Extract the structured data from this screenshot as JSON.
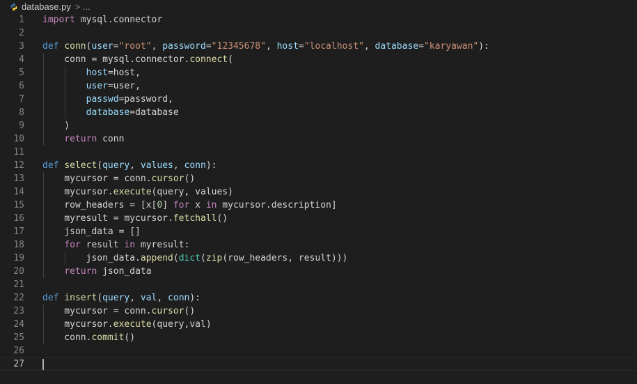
{
  "breadcrumb": {
    "file": "database.py",
    "separator": ">",
    "more": "..."
  },
  "editor": {
    "lines": [
      {
        "n": "1",
        "tokens": [
          [
            "c",
            "import"
          ],
          [
            "d",
            " mysql.connector"
          ]
        ]
      },
      {
        "n": "2",
        "tokens": []
      },
      {
        "n": "3",
        "tokens": [
          [
            "k",
            "def"
          ],
          [
            "d",
            " "
          ],
          [
            "f",
            "conn"
          ],
          [
            "d",
            "("
          ],
          [
            "p",
            "user"
          ],
          [
            "d",
            "="
          ],
          [
            "s",
            "\"root\""
          ],
          [
            "d",
            ", "
          ],
          [
            "p",
            "password"
          ],
          [
            "d",
            "="
          ],
          [
            "s",
            "\"12345678\""
          ],
          [
            "d",
            ", "
          ],
          [
            "p",
            "host"
          ],
          [
            "d",
            "="
          ],
          [
            "s",
            "\"localhost\""
          ],
          [
            "d",
            ", "
          ],
          [
            "p",
            "database"
          ],
          [
            "d",
            "="
          ],
          [
            "s",
            "\"karyawan\""
          ],
          [
            "d",
            "):"
          ]
        ]
      },
      {
        "n": "4",
        "tokens": [
          [
            "d",
            "    conn = mysql.connector."
          ],
          [
            "f",
            "connect"
          ],
          [
            "d",
            "("
          ]
        ]
      },
      {
        "n": "5",
        "tokens": [
          [
            "d",
            "        "
          ],
          [
            "p",
            "host"
          ],
          [
            "d",
            "=host,"
          ]
        ]
      },
      {
        "n": "6",
        "tokens": [
          [
            "d",
            "        "
          ],
          [
            "p",
            "user"
          ],
          [
            "d",
            "=user,"
          ]
        ]
      },
      {
        "n": "7",
        "tokens": [
          [
            "d",
            "        "
          ],
          [
            "p",
            "passwd"
          ],
          [
            "d",
            "=password,"
          ]
        ]
      },
      {
        "n": "8",
        "tokens": [
          [
            "d",
            "        "
          ],
          [
            "p",
            "database"
          ],
          [
            "d",
            "=database"
          ]
        ]
      },
      {
        "n": "9",
        "tokens": [
          [
            "d",
            "    )"
          ]
        ]
      },
      {
        "n": "10",
        "tokens": [
          [
            "d",
            "    "
          ],
          [
            "c",
            "return"
          ],
          [
            "d",
            " conn"
          ]
        ]
      },
      {
        "n": "11",
        "tokens": []
      },
      {
        "n": "12",
        "tokens": [
          [
            "k",
            "def"
          ],
          [
            "d",
            " "
          ],
          [
            "f",
            "select"
          ],
          [
            "d",
            "("
          ],
          [
            "p",
            "query"
          ],
          [
            "d",
            ", "
          ],
          [
            "p",
            "values"
          ],
          [
            "d",
            ", "
          ],
          [
            "p",
            "conn"
          ],
          [
            "d",
            "):"
          ]
        ]
      },
      {
        "n": "13",
        "tokens": [
          [
            "d",
            "    mycursor = conn."
          ],
          [
            "f",
            "cursor"
          ],
          [
            "d",
            "()"
          ]
        ]
      },
      {
        "n": "14",
        "tokens": [
          [
            "d",
            "    mycursor."
          ],
          [
            "f",
            "execute"
          ],
          [
            "d",
            "(query, values)"
          ]
        ]
      },
      {
        "n": "15",
        "tokens": [
          [
            "d",
            "    row_headers = [x["
          ],
          [
            "n",
            "0"
          ],
          [
            "d",
            "] "
          ],
          [
            "c",
            "for"
          ],
          [
            "d",
            " x "
          ],
          [
            "c",
            "in"
          ],
          [
            "d",
            " mycursor.description]"
          ]
        ]
      },
      {
        "n": "16",
        "tokens": [
          [
            "d",
            "    myresult = mycursor."
          ],
          [
            "f",
            "fetchall"
          ],
          [
            "d",
            "()"
          ]
        ]
      },
      {
        "n": "17",
        "tokens": [
          [
            "d",
            "    json_data = []"
          ]
        ]
      },
      {
        "n": "18",
        "tokens": [
          [
            "d",
            "    "
          ],
          [
            "c",
            "for"
          ],
          [
            "d",
            " result "
          ],
          [
            "c",
            "in"
          ],
          [
            "d",
            " myresult:"
          ]
        ]
      },
      {
        "n": "19",
        "tokens": [
          [
            "d",
            "        json_data."
          ],
          [
            "f",
            "append"
          ],
          [
            "d",
            "("
          ],
          [
            "t",
            "dict"
          ],
          [
            "d",
            "("
          ],
          [
            "f",
            "zip"
          ],
          [
            "d",
            "(row_headers, result)))"
          ]
        ]
      },
      {
        "n": "20",
        "tokens": [
          [
            "d",
            "    "
          ],
          [
            "c",
            "return"
          ],
          [
            "d",
            " json_data"
          ]
        ]
      },
      {
        "n": "21",
        "tokens": []
      },
      {
        "n": "22",
        "tokens": [
          [
            "k",
            "def"
          ],
          [
            "d",
            " "
          ],
          [
            "f",
            "insert"
          ],
          [
            "d",
            "("
          ],
          [
            "p",
            "query"
          ],
          [
            "d",
            ", "
          ],
          [
            "p",
            "val"
          ],
          [
            "d",
            ", "
          ],
          [
            "p",
            "conn"
          ],
          [
            "d",
            "):"
          ]
        ]
      },
      {
        "n": "23",
        "tokens": [
          [
            "d",
            "    mycursor = conn."
          ],
          [
            "f",
            "cursor"
          ],
          [
            "d",
            "()"
          ]
        ]
      },
      {
        "n": "24",
        "tokens": [
          [
            "d",
            "    mycursor."
          ],
          [
            "f",
            "execute"
          ],
          [
            "d",
            "(query,val)"
          ]
        ]
      },
      {
        "n": "25",
        "tokens": [
          [
            "d",
            "    conn."
          ],
          [
            "f",
            "commit"
          ],
          [
            "d",
            "()"
          ]
        ]
      },
      {
        "n": "26",
        "tokens": []
      },
      {
        "n": "27",
        "tokens": []
      }
    ],
    "current_line": "27"
  }
}
